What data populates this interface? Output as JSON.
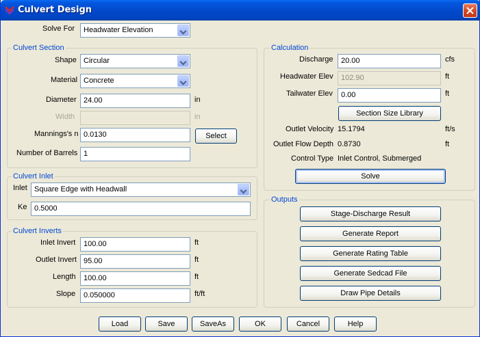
{
  "window": {
    "title": "Culvert Design",
    "icon": "app-logo-icon",
    "close_icon": "close-icon"
  },
  "solve_for": {
    "label": "Solve For",
    "value": "Headwater Elevation"
  },
  "culvert_section": {
    "title": "Culvert Section",
    "shape": {
      "label": "Shape",
      "value": "Circular"
    },
    "material": {
      "label": "Material",
      "value": "Concrete"
    },
    "diameter": {
      "label": "Diameter",
      "value": "24.00",
      "unit": "in"
    },
    "width": {
      "label": "Width",
      "value": "",
      "unit": "in"
    },
    "mannings": {
      "label": "Mannings's n",
      "value": "0.0130",
      "button": "Select"
    },
    "barrels": {
      "label": "Number of Barrels",
      "value": "1"
    }
  },
  "culvert_inlet": {
    "title": "Culvert Inlet",
    "inlet": {
      "label": "Inlet",
      "value": "Square Edge with Headwall"
    },
    "ke": {
      "label": "Ke",
      "value": "0.5000"
    }
  },
  "culvert_inverts": {
    "title": "Culvert Inverts",
    "inlet_invert": {
      "label": "Inlet Invert",
      "value": "100.00",
      "unit": "ft"
    },
    "outlet_invert": {
      "label": "Outlet Invert",
      "value": "95.00",
      "unit": "ft"
    },
    "length": {
      "label": "Length",
      "value": "100.00",
      "unit": "ft"
    },
    "slope": {
      "label": "Slope",
      "value": "0.050000",
      "unit": "ft/ft"
    }
  },
  "calculation": {
    "title": "Calculation",
    "discharge": {
      "label": "Discharge",
      "value": "20.00",
      "unit": "cfs"
    },
    "headwater": {
      "label": "Headwater Elev",
      "value": "102.90",
      "unit": "ft"
    },
    "tailwater": {
      "label": "Tailwater Elev",
      "value": "0.00",
      "unit": "ft"
    },
    "section_library_button": "Section Size Library",
    "outlet_velocity": {
      "label": "Outlet Velocity",
      "value": "15.1794",
      "unit": "ft/s"
    },
    "outlet_flow_depth": {
      "label": "Outlet Flow Depth",
      "value": "0.8730",
      "unit": "ft"
    },
    "control_type": {
      "label": "Control Type",
      "value": "Inlet Control, Submerged"
    },
    "solve_button": "Solve"
  },
  "outputs": {
    "title": "Outputs",
    "buttons": [
      "Stage-Discharge Result",
      "Generate Report",
      "Generate Rating Table",
      "Generate Sedcad File",
      "Draw Pipe Details"
    ]
  },
  "footer": {
    "load": "Load",
    "save": "Save",
    "saveas": "SaveAs",
    "ok": "OK",
    "cancel": "Cancel",
    "help": "Help"
  },
  "colors": {
    "titlebar": "#0248c9",
    "group_title": "#0046d5",
    "face": "#ece9d8",
    "input_border": "#7f9db9"
  }
}
